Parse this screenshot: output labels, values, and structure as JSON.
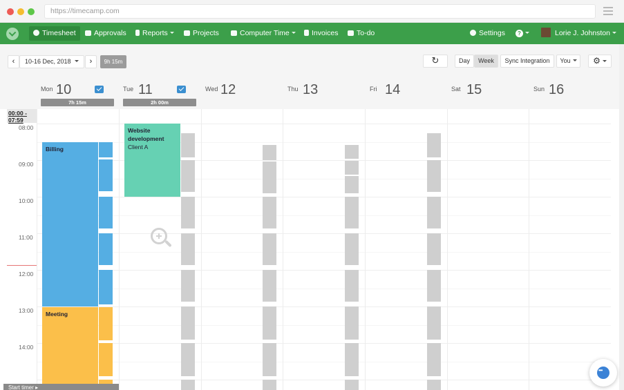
{
  "browser": {
    "url": "https://timecamp.com"
  },
  "nav": {
    "items": [
      {
        "label": "Timesheet",
        "icon": "clock-icon",
        "active": true
      },
      {
        "label": "Approvals",
        "icon": "car-icon"
      },
      {
        "label": "Reports",
        "icon": "document-icon",
        "dropdown": true
      },
      {
        "label": "Projects",
        "icon": "folder-icon"
      },
      {
        "label": "Computer Time",
        "icon": "monitor-icon",
        "dropdown": true
      },
      {
        "label": "Invoices",
        "icon": "invoice-icon"
      },
      {
        "label": "To-do",
        "icon": "checkbox-icon"
      }
    ],
    "settings_label": "Settings",
    "help_label": "?",
    "user_name": "Lorie J. Johnston",
    "accent_color": "#3c9f4a"
  },
  "toolbar": {
    "prev": "‹",
    "date_range": "10-16 Dec, 2018",
    "next": "›",
    "week_total": "9h 15m",
    "refresh_icon": "refresh-icon",
    "view_day": "Day",
    "view_week": "Week",
    "sync_label": "Sync Integration",
    "user_filter": "You",
    "settings_icon": "gear-icon"
  },
  "days": [
    {
      "name": "Mon",
      "num": "10",
      "total": "7h 15m",
      "has_mail": true
    },
    {
      "name": "Tue",
      "num": "11",
      "total": "2h 00m",
      "has_mail": true
    },
    {
      "name": "Wed",
      "num": "12"
    },
    {
      "name": "Thu",
      "num": "13"
    },
    {
      "name": "Fri",
      "num": "14"
    },
    {
      "name": "Sat",
      "num": "15"
    },
    {
      "name": "Sun",
      "num": "16"
    }
  ],
  "times": {
    "midnight_range": "00:00 - 07:59",
    "hours": [
      "08:00",
      "09:00",
      "10:00",
      "11:00",
      "12:00",
      "13:00",
      "14:00"
    ]
  },
  "entries": {
    "billing": {
      "title": "Billing",
      "color": "#55aee3"
    },
    "meeting": {
      "title": "Meeting",
      "color": "#fbbf4a"
    },
    "website": {
      "title": "Website development",
      "subtitle": "Client A",
      "color": "#66d1b3"
    }
  },
  "footer": {
    "start_timer": "Start timer ▸"
  }
}
